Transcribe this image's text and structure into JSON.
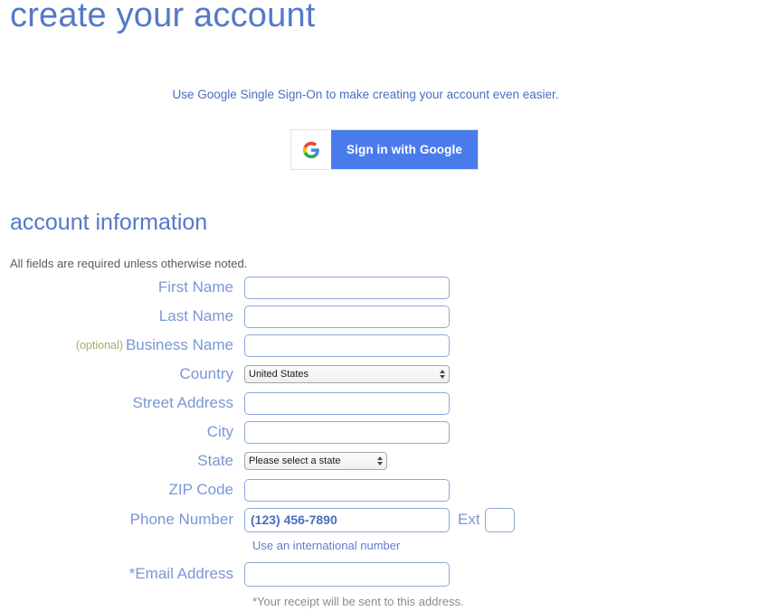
{
  "page": {
    "title": "create your account"
  },
  "sso": {
    "note": "Use Google Single Sign-On to make creating your account even easier.",
    "button_label": "Sign in with Google",
    "icon": "google-g-icon",
    "button_color": "#4a7bec"
  },
  "account_section": {
    "title": "account information",
    "required_note": "All fields are required unless otherwise noted."
  },
  "form": {
    "first_name": {
      "label": "First Name",
      "value": "",
      "placeholder": ""
    },
    "last_name": {
      "label": "Last Name",
      "value": "",
      "placeholder": ""
    },
    "business_name": {
      "optional_tag": "(optional)",
      "label": "Business Name",
      "value": "",
      "placeholder": ""
    },
    "country": {
      "label": "Country",
      "selected": "United States",
      "options": [
        "United States"
      ]
    },
    "street_address": {
      "label": "Street Address",
      "value": "",
      "placeholder": ""
    },
    "city": {
      "label": "City",
      "value": "",
      "placeholder": ""
    },
    "state": {
      "label": "State",
      "selected": "Please select a state",
      "options": [
        "Please select a state"
      ]
    },
    "zip_code": {
      "label": "ZIP Code",
      "value": "",
      "placeholder": ""
    },
    "phone_number": {
      "label": "Phone Number",
      "value": "",
      "placeholder": "(123) 456-7890",
      "ext_label": "Ext",
      "ext_value": "",
      "hint": "Use an international number"
    },
    "email_address": {
      "label": "*Email Address",
      "value": "",
      "placeholder": "",
      "hint": "*Your receipt will be sent to this address."
    }
  },
  "colors": {
    "heading_blue": "#5379c8",
    "label_blue": "#7b96d4",
    "optional_olive": "#a9a867",
    "input_border": "#8ea7d9",
    "google_blue": "#4a7bec",
    "hint_gray": "#8a8a8a"
  }
}
